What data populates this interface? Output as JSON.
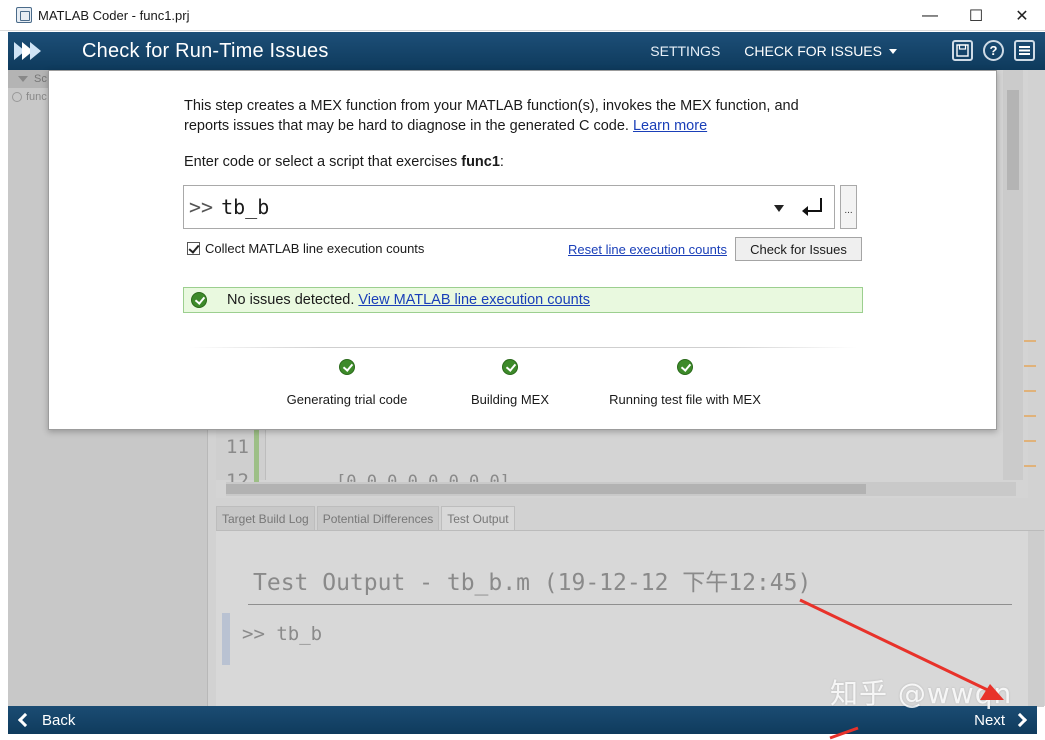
{
  "window": {
    "title": "MATLAB Coder - func1.prj",
    "minimize": "—",
    "maximize": "☐",
    "close": "✕"
  },
  "header": {
    "page_title": "Check for Run-Time Issues",
    "nav": [
      {
        "label": "SETTINGS"
      },
      {
        "label": "CHECK FOR ISSUES"
      }
    ],
    "help_label": "?"
  },
  "left_panel": {
    "head": "Sc",
    "row": "func"
  },
  "editor": {
    "line_11": "11",
    "line_12": "12",
    "code_12": "[0 0 0 0 0 0 0 0]"
  },
  "bottom_tabs": [
    {
      "label": "Target Build Log"
    },
    {
      "label": "Potential Differences"
    },
    {
      "label": "Test Output"
    }
  ],
  "output": {
    "heading": "Test Output - tb_b.m   (19-12-12 下午12:45)",
    "command": ">> tb_b"
  },
  "dialog": {
    "intro": "This step creates a MEX function from your MATLAB function(s), invokes the MEX function, and reports issues that may be hard to diagnose in the generated C code.",
    "learn_more": "Learn more",
    "prompt_label": "Enter code or select a script that exercises",
    "function_name": "func1",
    "prompt_suffix": ":",
    "cmd_prompt": ">>",
    "cmd_value": "tb_b",
    "browse_label": "...",
    "collect_label": "Collect MATLAB line execution counts",
    "reset_link": "Reset line execution counts",
    "check_button": "Check for Issues",
    "result_text": "No issues detected.",
    "result_link": "View MATLAB line execution counts",
    "steps": [
      {
        "label": "Generating trial code"
      },
      {
        "label": "Building MEX"
      },
      {
        "label": "Running test file with MEX"
      }
    ]
  },
  "footer": {
    "back": "Back",
    "next": "Next"
  },
  "watermark": "知乎 @wwqn",
  "colors": {
    "header_bg": "#0e3a5c",
    "link": "#1a3fb8",
    "success_bg": "#e9f9df",
    "success_icon": "#3d8a2a",
    "annotation_arrow": "#e8322a"
  }
}
